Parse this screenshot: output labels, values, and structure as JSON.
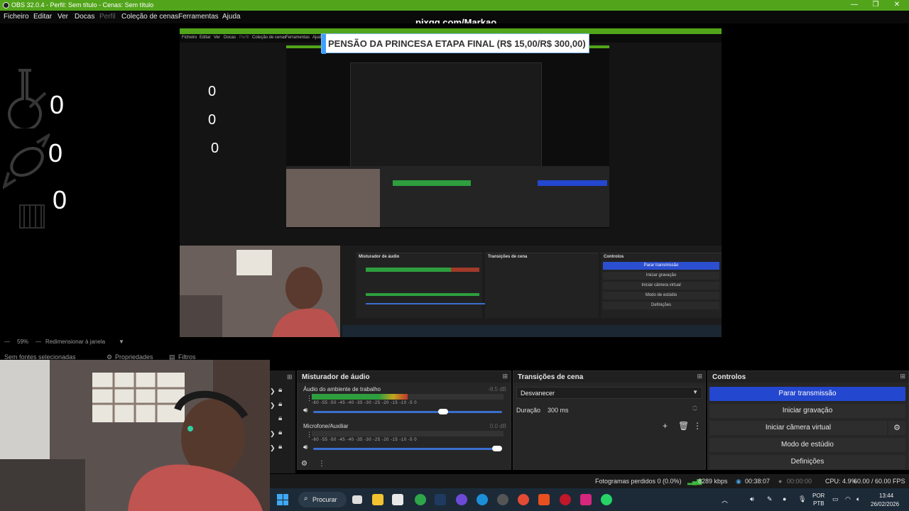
{
  "window": {
    "title": "OBS 32.0.4 - Perfil: Sem título - Cenas: Sem título",
    "minimize": "—",
    "maximize": "❐",
    "close": "✕"
  },
  "menu": {
    "items": [
      "Ficheiro",
      "Editar",
      "Ver",
      "Docas",
      "Perfil",
      "Coleção de cenas",
      "Ferramentas",
      "Ajuda"
    ]
  },
  "watermark": "pixgg.com/Markao",
  "banner": "PENSÃO DA PRINCESA ETAPA FINAL (R$ 15,00/R$ 300,00)",
  "counters": [
    "0",
    "0",
    "0"
  ],
  "nested": {
    "menu": [
      "Ficheiro",
      "Editar",
      "Ver",
      "Docas",
      "Perfil",
      "Coleção de cenas",
      "Ferramentas",
      "Ajuda"
    ],
    "counters": [
      "0",
      "0",
      "0"
    ],
    "mixer_title": "Misturador de áudio",
    "transitions_title": "Transições de cena",
    "controls_title": "Controlos",
    "stream_btn": "Parar transmissão",
    "ctrl_buttons": [
      "Iniciar gravação",
      "Iniciar câmera virtual",
      "Modo de estúdio",
      "Definições"
    ]
  },
  "zoom": {
    "percent": "59%",
    "resize": "Redimensionar à janela"
  },
  "dock_tabs": {
    "sources": "Sem fontes selecionadas",
    "properties": "Propriedades",
    "filters": "Filtros"
  },
  "mixer": {
    "title": "Misturador de áudio",
    "tracks": [
      {
        "name": "Áudio do ambiente de trabalho",
        "db": "-8.5 dB",
        "level": 0.5,
        "volume": 0.7
      },
      {
        "name": "Microfone/Auxiliar",
        "db": "0.0 dB",
        "level": 0.0,
        "volume": 1.0
      }
    ],
    "scale": "-60  -55  -50  -45  -40  -35  -30  -25  -20  -15  -10   -5    0"
  },
  "transitions": {
    "title": "Transições de cena",
    "selected": "Desvanecer",
    "duration_label": "Duração",
    "duration_value": "300 ms"
  },
  "controls": {
    "title": "Controlos",
    "stream": "Parar transmissão",
    "record": "Iniciar gravação",
    "virtual_cam": "Iniciar câmera virtual",
    "studio": "Modo de estúdio",
    "settings": "Definições"
  },
  "status": {
    "dropped": "Fotogramas perdidos 0 (0.0%)",
    "bitrate": "8289 kbps",
    "live_time": "00:38:07",
    "rec_time": "00:00:00",
    "cpu": "CPU: 4.9%",
    "fps": "60.00 / 60.00 FPS"
  },
  "taskbar": {
    "search": "Procurar",
    "lang1": "POR",
    "lang2": "PTB",
    "time": "13:44",
    "date": "26/02/2026"
  },
  "colors": {
    "obs_green": "#52a51b",
    "stream_blue": "#2447cf",
    "taskbar": "#1c2a38"
  }
}
